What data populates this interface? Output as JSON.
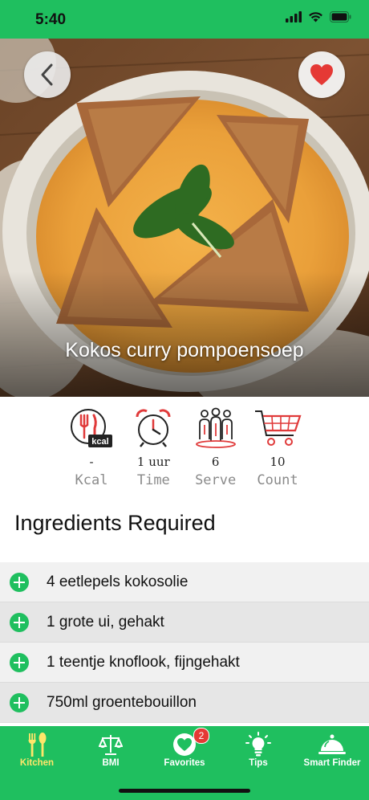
{
  "status_bar": {
    "time": "5:40",
    "icons": [
      "signal-icon",
      "wifi-icon",
      "battery-icon"
    ]
  },
  "recipe": {
    "title": "Kokos curry pompoensoep",
    "favorite": true
  },
  "stats": [
    {
      "icon": "kcal-icon",
      "value": "-",
      "label": "Kcal"
    },
    {
      "icon": "alarm-clock-icon",
      "value": "1 uur",
      "label": "Time"
    },
    {
      "icon": "people-icon",
      "value": "6",
      "label": "Serve"
    },
    {
      "icon": "cart-icon",
      "value": "10",
      "label": "Count"
    }
  ],
  "ingredients_title": "Ingredients Required",
  "ingredients": [
    "4 eetlepels kokosolie",
    "1 grote ui, gehakt",
    "1 teentje knoflook, fijngehakt",
    "750ml groentebouillon"
  ],
  "tabs": [
    {
      "label": "Kitchen",
      "icon": "fork-spoon-icon",
      "active": true
    },
    {
      "label": "BMI",
      "icon": "scale-icon",
      "active": false
    },
    {
      "label": "Favorites",
      "icon": "heart-icon",
      "active": false,
      "badge": "2"
    },
    {
      "label": "Tips",
      "icon": "lightbulb-icon",
      "active": false
    },
    {
      "label": "Smart Finder",
      "icon": "cloche-icon",
      "active": false
    }
  ],
  "colors": {
    "brand": "#1fbf5f",
    "active_tab": "#ffe66a",
    "heart": "#e53935",
    "icon_red": "#e03a3a"
  }
}
